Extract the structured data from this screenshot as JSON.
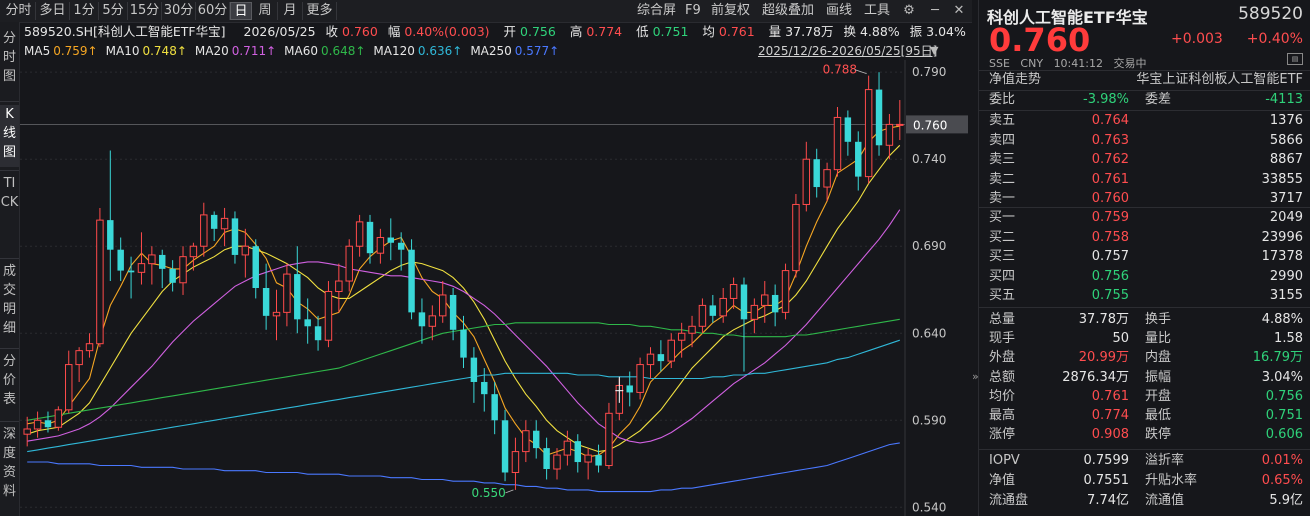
{
  "toolbar": {
    "periods": [
      "分时",
      "多日",
      "1分",
      "5分",
      "15分",
      "30分",
      "60分",
      "日",
      "周",
      "月",
      "更多"
    ],
    "active_period": "日",
    "right_items": [
      "综合屏",
      "F9",
      "前复权",
      "超级叠加",
      "画线",
      "工具"
    ],
    "icons": [
      "gear-icon",
      "minimize-icon",
      "close-icon"
    ]
  },
  "side_tabs": [
    "分时图",
    "K线图",
    "TICK",
    "成交明细",
    "分价表",
    "深度资料"
  ],
  "active_side_tab": "K线图",
  "header": {
    "symbol": "589520.SH[科创人工智能ETF华宝]",
    "date": "2026/05/25",
    "close_label": "收",
    "close": "0.760",
    "amp_label": "幅",
    "amp": "0.40%(0.003)",
    "open_label": "开",
    "open": "0.756",
    "high_label": "高",
    "high": "0.774",
    "low_label": "低",
    "low": "0.751",
    "avg_label": "均",
    "avg": "0.761",
    "vol_label": "量",
    "vol": "37.78万",
    "turn_label": "换",
    "turn": "4.88%",
    "swing_label": "振",
    "swing": "3.04%"
  },
  "ma_legend": [
    {
      "name": "MA5",
      "value": "0.759↑",
      "color": "#f5a623"
    },
    {
      "name": "MA10",
      "value": "0.748↑",
      "color": "#f0e040"
    },
    {
      "name": "MA20",
      "value": "0.711↑",
      "color": "#d060e0"
    },
    {
      "name": "MA60",
      "value": "0.648↑",
      "color": "#2fb84a"
    },
    {
      "name": "MA120",
      "value": "0.636↑",
      "color": "#30b8d8"
    },
    {
      "name": "MA250",
      "value": "0.577↑",
      "color": "#4a78ff"
    }
  ],
  "date_range": "2025/12/26-2026/05/25[95日]",
  "chart_data": {
    "type": "candlestick",
    "ylim": [
      0.535,
      0.797
    ],
    "y_ticks": [
      "0.790",
      "0.740",
      "0.690",
      "0.640",
      "0.590",
      "0.540"
    ],
    "last_price_label": "0.760",
    "annotations": [
      {
        "text": "0.788",
        "index": 81,
        "value": 0.788
      },
      {
        "text": "0.550",
        "index": 47,
        "value": 0.55
      }
    ],
    "candles": [
      [
        0.582,
        0.592,
        0.575,
        0.585
      ],
      [
        0.585,
        0.595,
        0.58,
        0.59
      ],
      [
        0.59,
        0.595,
        0.583,
        0.586
      ],
      [
        0.586,
        0.598,
        0.584,
        0.596
      ],
      [
        0.596,
        0.63,
        0.594,
        0.622
      ],
      [
        0.622,
        0.632,
        0.612,
        0.63
      ],
      [
        0.63,
        0.64,
        0.626,
        0.634
      ],
      [
        0.634,
        0.712,
        0.632,
        0.705
      ],
      [
        0.705,
        0.745,
        0.67,
        0.688
      ],
      [
        0.688,
        0.695,
        0.67,
        0.676
      ],
      [
        0.676,
        0.684,
        0.66,
        0.675
      ],
      [
        0.675,
        0.698,
        0.668,
        0.68
      ],
      [
        0.68,
        0.69,
        0.668,
        0.685
      ],
      [
        0.685,
        0.688,
        0.666,
        0.677
      ],
      [
        0.677,
        0.682,
        0.664,
        0.669
      ],
      [
        0.669,
        0.69,
        0.662,
        0.684
      ],
      [
        0.684,
        0.692,
        0.676,
        0.69
      ],
      [
        0.69,
        0.715,
        0.684,
        0.708
      ],
      [
        0.708,
        0.71,
        0.693,
        0.7
      ],
      [
        0.7,
        0.712,
        0.69,
        0.706
      ],
      [
        0.706,
        0.71,
        0.68,
        0.685
      ],
      [
        0.685,
        0.7,
        0.672,
        0.69
      ],
      [
        0.69,
        0.694,
        0.66,
        0.666
      ],
      [
        0.666,
        0.68,
        0.642,
        0.65
      ],
      [
        0.65,
        0.665,
        0.636,
        0.652
      ],
      [
        0.652,
        0.68,
        0.644,
        0.674
      ],
      [
        0.674,
        0.69,
        0.64,
        0.648
      ],
      [
        0.648,
        0.66,
        0.634,
        0.644
      ],
      [
        0.644,
        0.65,
        0.63,
        0.636
      ],
      [
        0.636,
        0.67,
        0.632,
        0.664
      ],
      [
        0.664,
        0.68,
        0.652,
        0.67
      ],
      [
        0.67,
        0.694,
        0.664,
        0.69
      ],
      [
        0.69,
        0.708,
        0.684,
        0.704
      ],
      [
        0.704,
        0.708,
        0.68,
        0.686
      ],
      [
        0.686,
        0.7,
        0.68,
        0.695
      ],
      [
        0.695,
        0.706,
        0.682,
        0.692
      ],
      [
        0.692,
        0.698,
        0.676,
        0.688
      ],
      [
        0.688,
        0.694,
        0.648,
        0.652
      ],
      [
        0.652,
        0.66,
        0.634,
        0.644
      ],
      [
        0.644,
        0.656,
        0.636,
        0.65
      ],
      [
        0.65,
        0.67,
        0.646,
        0.662
      ],
      [
        0.662,
        0.666,
        0.636,
        0.642
      ],
      [
        0.642,
        0.65,
        0.62,
        0.626
      ],
      [
        0.626,
        0.632,
        0.6,
        0.612
      ],
      [
        0.612,
        0.62,
        0.595,
        0.605
      ],
      [
        0.605,
        0.612,
        0.582,
        0.59
      ],
      [
        0.59,
        0.596,
        0.555,
        0.56
      ],
      [
        0.56,
        0.58,
        0.55,
        0.572
      ],
      [
        0.572,
        0.59,
        0.566,
        0.584
      ],
      [
        0.584,
        0.59,
        0.568,
        0.574
      ],
      [
        0.574,
        0.58,
        0.556,
        0.562
      ],
      [
        0.562,
        0.574,
        0.556,
        0.57
      ],
      [
        0.57,
        0.584,
        0.564,
        0.578
      ],
      [
        0.578,
        0.582,
        0.56,
        0.566
      ],
      [
        0.566,
        0.574,
        0.556,
        0.57
      ],
      [
        0.57,
        0.576,
        0.56,
        0.564
      ],
      [
        0.564,
        0.6,
        0.562,
        0.594
      ],
      [
        0.594,
        0.614,
        0.59,
        0.61
      ],
      [
        0.61,
        0.618,
        0.598,
        0.606
      ],
      [
        0.606,
        0.626,
        0.602,
        0.622
      ],
      [
        0.622,
        0.632,
        0.614,
        0.628
      ],
      [
        0.628,
        0.636,
        0.618,
        0.624
      ],
      [
        0.624,
        0.64,
        0.62,
        0.636
      ],
      [
        0.636,
        0.646,
        0.626,
        0.64
      ],
      [
        0.64,
        0.65,
        0.632,
        0.644
      ],
      [
        0.644,
        0.66,
        0.64,
        0.656
      ],
      [
        0.656,
        0.662,
        0.646,
        0.65
      ],
      [
        0.65,
        0.666,
        0.646,
        0.66
      ],
      [
        0.66,
        0.672,
        0.654,
        0.668
      ],
      [
        0.668,
        0.672,
        0.618,
        0.648
      ],
      [
        0.648,
        0.66,
        0.64,
        0.656
      ],
      [
        0.656,
        0.67,
        0.646,
        0.662
      ],
      [
        0.662,
        0.668,
        0.644,
        0.652
      ],
      [
        0.652,
        0.68,
        0.648,
        0.676
      ],
      [
        0.676,
        0.72,
        0.672,
        0.714
      ],
      [
        0.714,
        0.75,
        0.71,
        0.74
      ],
      [
        0.74,
        0.746,
        0.718,
        0.724
      ],
      [
        0.724,
        0.738,
        0.716,
        0.734
      ],
      [
        0.734,
        0.77,
        0.73,
        0.764
      ],
      [
        0.764,
        0.768,
        0.742,
        0.75
      ],
      [
        0.75,
        0.756,
        0.722,
        0.73
      ],
      [
        0.73,
        0.788,
        0.726,
        0.78
      ],
      [
        0.78,
        0.79,
        0.742,
        0.748
      ],
      [
        0.748,
        0.766,
        0.74,
        0.76
      ],
      [
        0.76,
        0.774,
        0.751,
        0.76
      ]
    ],
    "ma_series": {
      "MA5": [
        0.588,
        0.589,
        0.588,
        0.59,
        0.598,
        0.606,
        0.614,
        0.637,
        0.656,
        0.667,
        0.679,
        0.686,
        0.68,
        0.679,
        0.677,
        0.677,
        0.682,
        0.686,
        0.69,
        0.698,
        0.7,
        0.698,
        0.691,
        0.683,
        0.669,
        0.666,
        0.658,
        0.654,
        0.648,
        0.65,
        0.652,
        0.662,
        0.677,
        0.684,
        0.689,
        0.693,
        0.695,
        0.684,
        0.672,
        0.664,
        0.66,
        0.652,
        0.646,
        0.638,
        0.625,
        0.612,
        0.597,
        0.588,
        0.58,
        0.576,
        0.57,
        0.572,
        0.574,
        0.572,
        0.569,
        0.57,
        0.574,
        0.582,
        0.588,
        0.598,
        0.612,
        0.618,
        0.624,
        0.63,
        0.634,
        0.64,
        0.646,
        0.65,
        0.656,
        0.652,
        0.652,
        0.656,
        0.656,
        0.66,
        0.674,
        0.69,
        0.704,
        0.716,
        0.732,
        0.736,
        0.74,
        0.75,
        0.756,
        0.758,
        0.759
      ],
      "MA10": [
        0.582,
        0.584,
        0.585,
        0.586,
        0.59,
        0.594,
        0.6,
        0.61,
        0.62,
        0.63,
        0.64,
        0.648,
        0.656,
        0.664,
        0.67,
        0.674,
        0.678,
        0.681,
        0.684,
        0.688,
        0.69,
        0.69,
        0.688,
        0.686,
        0.683,
        0.68,
        0.676,
        0.672,
        0.666,
        0.662,
        0.66,
        0.66,
        0.664,
        0.668,
        0.672,
        0.676,
        0.679,
        0.681,
        0.68,
        0.678,
        0.676,
        0.672,
        0.666,
        0.658,
        0.648,
        0.636,
        0.624,
        0.614,
        0.605,
        0.598,
        0.59,
        0.584,
        0.58,
        0.576,
        0.574,
        0.572,
        0.573,
        0.576,
        0.58,
        0.584,
        0.59,
        0.596,
        0.604,
        0.612,
        0.62,
        0.626,
        0.632,
        0.638,
        0.642,
        0.645,
        0.648,
        0.65,
        0.653,
        0.656,
        0.662,
        0.67,
        0.68,
        0.69,
        0.7,
        0.708,
        0.716,
        0.726,
        0.734,
        0.742,
        0.748
      ],
      "MA20": [
        0.578,
        0.579,
        0.58,
        0.581,
        0.583,
        0.585,
        0.588,
        0.592,
        0.597,
        0.603,
        0.609,
        0.615,
        0.621,
        0.628,
        0.635,
        0.641,
        0.647,
        0.652,
        0.657,
        0.662,
        0.667,
        0.67,
        0.673,
        0.675,
        0.677,
        0.679,
        0.68,
        0.681,
        0.681,
        0.68,
        0.679,
        0.677,
        0.676,
        0.675,
        0.674,
        0.673,
        0.673,
        0.672,
        0.671,
        0.67,
        0.669,
        0.667,
        0.664,
        0.66,
        0.656,
        0.651,
        0.645,
        0.639,
        0.633,
        0.627,
        0.621,
        0.614,
        0.607,
        0.6,
        0.594,
        0.588,
        0.584,
        0.58,
        0.578,
        0.577,
        0.578,
        0.58,
        0.583,
        0.587,
        0.591,
        0.596,
        0.601,
        0.606,
        0.611,
        0.615,
        0.619,
        0.623,
        0.628,
        0.633,
        0.639,
        0.645,
        0.652,
        0.659,
        0.666,
        0.673,
        0.68,
        0.687,
        0.694,
        0.702,
        0.711
      ],
      "MA60": [
        0.59,
        0.591,
        0.592,
        0.593,
        0.594,
        0.595,
        0.596,
        0.597,
        0.598,
        0.599,
        0.6,
        0.601,
        0.602,
        0.603,
        0.604,
        0.605,
        0.606,
        0.607,
        0.608,
        0.609,
        0.61,
        0.611,
        0.612,
        0.613,
        0.614,
        0.615,
        0.616,
        0.617,
        0.618,
        0.619,
        0.62,
        0.622,
        0.624,
        0.626,
        0.628,
        0.63,
        0.632,
        0.634,
        0.636,
        0.638,
        0.64,
        0.641,
        0.642,
        0.643,
        0.644,
        0.645,
        0.645,
        0.646,
        0.646,
        0.646,
        0.646,
        0.646,
        0.646,
        0.646,
        0.646,
        0.646,
        0.645,
        0.645,
        0.645,
        0.644,
        0.644,
        0.643,
        0.642,
        0.642,
        0.641,
        0.64,
        0.64,
        0.639,
        0.639,
        0.638,
        0.638,
        0.638,
        0.638,
        0.638,
        0.639,
        0.639,
        0.64,
        0.641,
        0.642,
        0.643,
        0.644,
        0.645,
        0.646,
        0.647,
        0.648
      ],
      "MA120": [
        0.572,
        0.573,
        0.574,
        0.575,
        0.576,
        0.577,
        0.578,
        0.579,
        0.58,
        0.581,
        0.582,
        0.583,
        0.584,
        0.585,
        0.586,
        0.587,
        0.588,
        0.589,
        0.59,
        0.591,
        0.592,
        0.593,
        0.594,
        0.595,
        0.596,
        0.597,
        0.598,
        0.599,
        0.6,
        0.601,
        0.602,
        0.603,
        0.604,
        0.605,
        0.606,
        0.607,
        0.608,
        0.609,
        0.61,
        0.611,
        0.612,
        0.613,
        0.614,
        0.615,
        0.616,
        0.616,
        0.617,
        0.617,
        0.617,
        0.617,
        0.617,
        0.617,
        0.617,
        0.616,
        0.616,
        0.616,
        0.615,
        0.615,
        0.615,
        0.615,
        0.614,
        0.614,
        0.614,
        0.614,
        0.614,
        0.614,
        0.615,
        0.615,
        0.616,
        0.616,
        0.617,
        0.617,
        0.618,
        0.619,
        0.62,
        0.621,
        0.622,
        0.623,
        0.625,
        0.626,
        0.628,
        0.63,
        0.632,
        0.634,
        0.636
      ],
      "MA250": [
        0.566,
        0.566,
        0.566,
        0.565,
        0.565,
        0.565,
        0.565,
        0.564,
        0.564,
        0.564,
        0.564,
        0.563,
        0.563,
        0.563,
        0.563,
        0.562,
        0.562,
        0.562,
        0.562,
        0.561,
        0.561,
        0.561,
        0.561,
        0.56,
        0.56,
        0.56,
        0.56,
        0.559,
        0.559,
        0.559,
        0.559,
        0.558,
        0.558,
        0.558,
        0.558,
        0.557,
        0.557,
        0.557,
        0.556,
        0.556,
        0.556,
        0.555,
        0.555,
        0.555,
        0.554,
        0.554,
        0.553,
        0.553,
        0.552,
        0.552,
        0.551,
        0.551,
        0.55,
        0.55,
        0.55,
        0.549,
        0.549,
        0.549,
        0.549,
        0.549,
        0.549,
        0.55,
        0.55,
        0.551,
        0.551,
        0.552,
        0.553,
        0.554,
        0.555,
        0.556,
        0.557,
        0.558,
        0.559,
        0.56,
        0.561,
        0.562,
        0.563,
        0.564,
        0.566,
        0.568,
        0.57,
        0.572,
        0.574,
        0.576,
        0.577
      ]
    }
  },
  "quote": {
    "title": "科创人工智能ETF华宝",
    "code": "589520",
    "price": "0.760",
    "change": "+0.003",
    "change_pct": "+0.40%",
    "meta": [
      "SSE",
      "CNY",
      "10:41:12",
      "交易中"
    ],
    "nav_label": "净值走势",
    "index_name": "华宝上证科创板人工智能ETF",
    "rong": "融",
    "weibi_label": "委比",
    "weibi": "-3.98%",
    "weicha_label": "委差",
    "weicha": "-4113",
    "asks": [
      {
        "label": "卖五",
        "price": "0.764",
        "vol": "1376"
      },
      {
        "label": "卖四",
        "price": "0.763",
        "vol": "5866"
      },
      {
        "label": "卖三",
        "price": "0.762",
        "vol": "8867"
      },
      {
        "label": "卖二",
        "price": "0.761",
        "vol": "33855"
      },
      {
        "label": "卖一",
        "price": "0.760",
        "vol": "3717"
      }
    ],
    "bids": [
      {
        "label": "买一",
        "price": "0.759",
        "vol": "2049"
      },
      {
        "label": "买二",
        "price": "0.758",
        "vol": "23996"
      },
      {
        "label": "买三",
        "price": "0.757",
        "vol": "17378"
      },
      {
        "label": "买四",
        "price": "0.756",
        "vol": "2990"
      },
      {
        "label": "买五",
        "price": "0.755",
        "vol": "3155"
      }
    ],
    "stats": [
      {
        "l1": "总量",
        "v1": "37.78万",
        "c1": "white",
        "l2": "换手",
        "v2": "4.88%",
        "c2": "white"
      },
      {
        "l1": "现手",
        "v1": "50",
        "c1": "white",
        "l2": "量比",
        "v2": "1.58",
        "c2": "white"
      },
      {
        "l1": "外盘",
        "v1": "20.99万",
        "c1": "red",
        "l2": "内盘",
        "v2": "16.79万",
        "c2": "green"
      },
      {
        "l1": "总额",
        "v1": "2876.34万",
        "c1": "white",
        "l2": "振幅",
        "v2": "3.04%",
        "c2": "white"
      },
      {
        "l1": "均价",
        "v1": "0.761",
        "c1": "red",
        "l2": "开盘",
        "v2": "0.756",
        "c2": "green"
      },
      {
        "l1": "最高",
        "v1": "0.774",
        "c1": "red",
        "l2": "最低",
        "v2": "0.751",
        "c2": "green"
      },
      {
        "l1": "涨停",
        "v1": "0.908",
        "c1": "red",
        "l2": "跌停",
        "v2": "0.606",
        "c2": "green"
      }
    ],
    "stats2": [
      {
        "l1": "IOPV",
        "v1": "0.7599",
        "c1": "white",
        "l2": "溢折率",
        "v2": "0.01%",
        "c2": "red"
      },
      {
        "l1": "净值",
        "v1": "0.7551",
        "c1": "white",
        "l2": "升贴水率",
        "v2": "0.65%",
        "c2": "red"
      },
      {
        "l1": "流通盘",
        "v1": "7.74亿",
        "c1": "white",
        "l2": "流通值",
        "v2": "5.9亿",
        "c2": "white"
      }
    ]
  }
}
